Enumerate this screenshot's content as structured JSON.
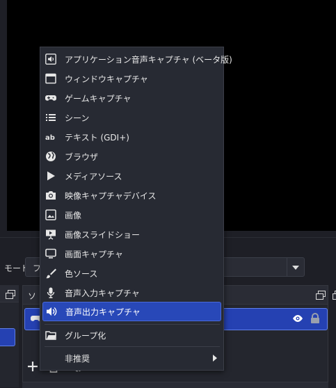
{
  "mode": {
    "label": "モード",
    "value": "フ"
  },
  "sources": {
    "title": "ソ"
  },
  "menu": {
    "items": [
      {
        "id": "app-audio",
        "label": "アプリケーション音声キャプチャ (ベータ版)",
        "icon": "app-audio-icon"
      },
      {
        "id": "window",
        "label": "ウィンドウキャプチャ",
        "icon": "window-icon"
      },
      {
        "id": "game",
        "label": "ゲームキャプチャ",
        "icon": "gamepad-icon"
      },
      {
        "id": "scene",
        "label": "シーン",
        "icon": "list-icon"
      },
      {
        "id": "text",
        "label": "テキスト (GDI+)",
        "icon": "text-icon"
      },
      {
        "id": "browser",
        "label": "ブラウザ",
        "icon": "globe-icon"
      },
      {
        "id": "media",
        "label": "メディアソース",
        "icon": "play-icon"
      },
      {
        "id": "video-capture",
        "label": "映像キャプチャデバイス",
        "icon": "camera-icon"
      },
      {
        "id": "image",
        "label": "画像",
        "icon": "image-icon"
      },
      {
        "id": "slideshow",
        "label": "画像スライドショー",
        "icon": "slideshow-icon"
      },
      {
        "id": "display",
        "label": "画面キャプチャ",
        "icon": "monitor-icon"
      },
      {
        "id": "color",
        "label": "色ソース",
        "icon": "brush-icon"
      },
      {
        "id": "audio-input",
        "label": "音声入力キャプチャ",
        "icon": "microphone-icon"
      },
      {
        "id": "audio-output",
        "label": "音声出力キャプチャ",
        "icon": "speaker-icon",
        "selected": true
      },
      {
        "id": "group",
        "label": "グループ化",
        "icon": "folder-icon"
      },
      {
        "id": "deprecated",
        "label": "非推奨",
        "icon": "",
        "submenu": true
      }
    ]
  },
  "colors": {
    "accent": "#2848b8",
    "menu_bg": "#272a33",
    "window_bg": "#1e1f26"
  }
}
